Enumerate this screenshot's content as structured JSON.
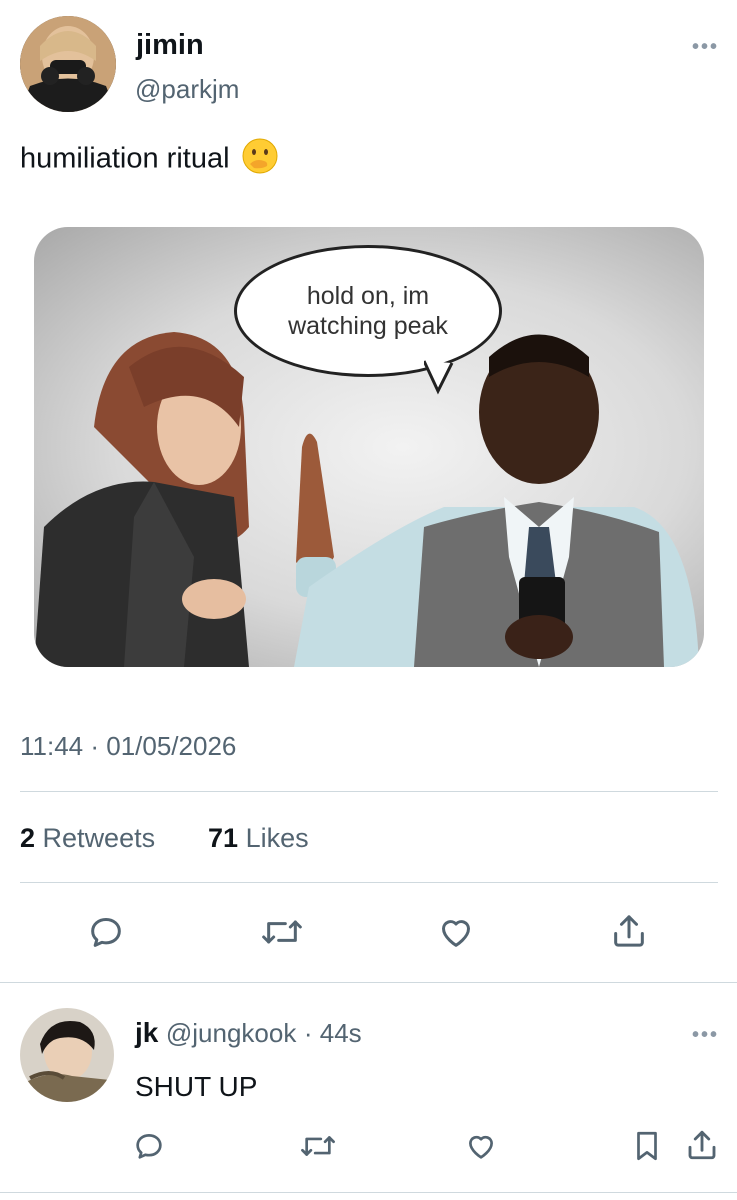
{
  "tweet": {
    "author_name": "jimin",
    "author_handle": "@parkjm",
    "text": "humiliation ritual",
    "emoji": "🫢",
    "image": {
      "bubble_text": "hold on, im watching peak"
    },
    "timestamp": "11:44 · 01/05/2026",
    "retweets_count": "2",
    "retweets_label": "Retweets",
    "likes_count": "71",
    "likes_label": "Likes"
  },
  "reply": {
    "author_name": "jk",
    "author_handle": "@jungkook",
    "time": "· 44s",
    "text": "SHUT UP"
  },
  "icons": {
    "reply": "reply-icon",
    "retweet": "retweet-icon",
    "like": "heart-icon",
    "share": "share-icon",
    "bookmark": "bookmark-icon",
    "more": "more-icon"
  },
  "colors": {
    "icon": "#536471",
    "divider": "#cfd9de",
    "text": "#0f1419"
  }
}
